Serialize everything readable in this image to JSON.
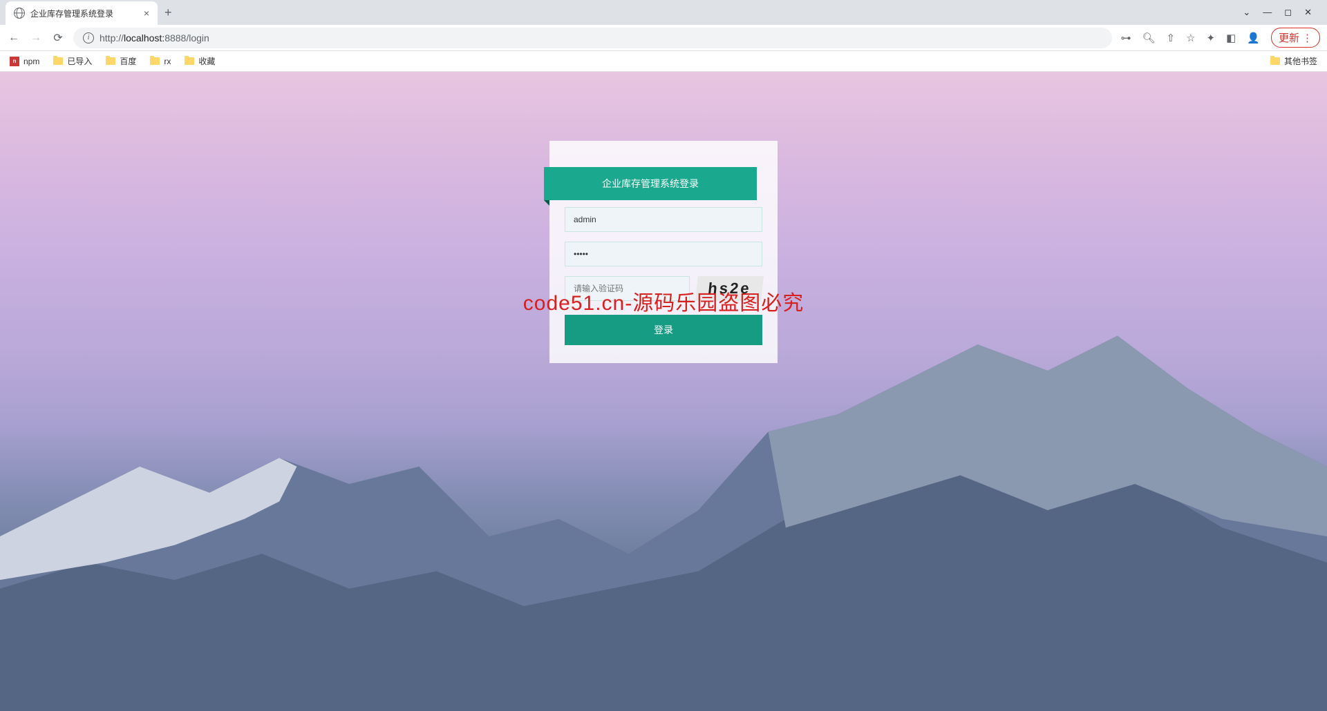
{
  "browser": {
    "tab_title": "企业库存管理系统登录",
    "url_host": "localhost:",
    "url_port": "8888",
    "url_path": "/login",
    "url_prefix": "http://",
    "update_label": "更新",
    "other_bookmarks": "其他书签"
  },
  "bookmarks": [
    {
      "icon": "npm",
      "label": "npm"
    },
    {
      "icon": "folder",
      "label": "已导入"
    },
    {
      "icon": "folder",
      "label": "百度"
    },
    {
      "icon": "folder",
      "label": "rx"
    },
    {
      "icon": "folder",
      "label": "收藏"
    }
  ],
  "login": {
    "title": "企业库存管理系统登录",
    "username_value": "admin",
    "password_value": "•••••",
    "captcha_placeholder": "请输入验证码",
    "captcha_text": "hs2e",
    "submit_label": "登录"
  },
  "watermark": "code51.cn-源码乐园盗图必究"
}
